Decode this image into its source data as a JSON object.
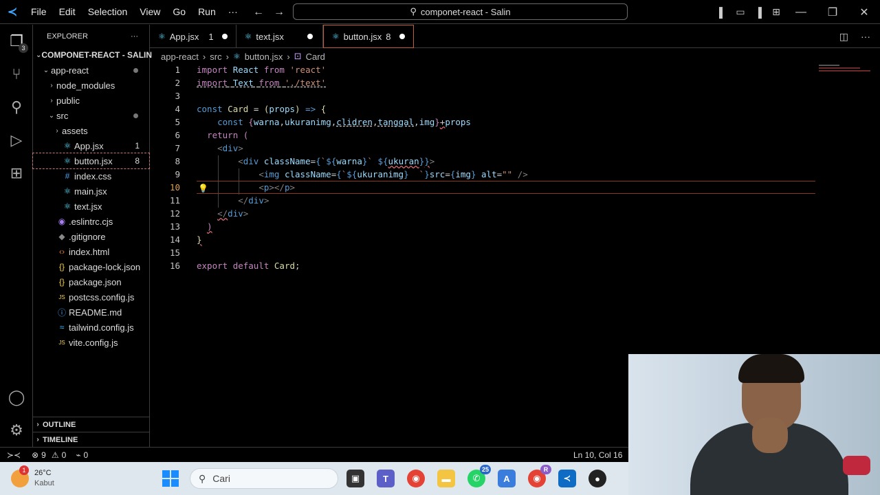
{
  "menu": [
    "File",
    "Edit",
    "Selection",
    "View",
    "Go",
    "Run",
    "···"
  ],
  "command_center": "componet-react - Salin",
  "activity": {
    "explorer_badge": "3"
  },
  "sidebar": {
    "header": "EXPLORER",
    "more": "···",
    "project": "COMPONET-REACT - SALIN",
    "items": [
      {
        "label": "app-react",
        "type": "folder-open",
        "indent": 1
      },
      {
        "label": "node_modules",
        "type": "folder",
        "indent": 2
      },
      {
        "label": "public",
        "type": "folder",
        "indent": 2
      },
      {
        "label": "src",
        "type": "folder-open",
        "indent": 2
      },
      {
        "label": "assets",
        "type": "folder",
        "indent": 3
      },
      {
        "label": "App.jsx",
        "type": "react",
        "indent": 3,
        "badge": "1"
      },
      {
        "label": "button.jsx",
        "type": "react",
        "indent": 3,
        "badge": "8"
      },
      {
        "label": "index.css",
        "type": "css",
        "indent": 3
      },
      {
        "label": "main.jsx",
        "type": "react",
        "indent": 3
      },
      {
        "label": "text.jsx",
        "type": "react",
        "indent": 3
      },
      {
        "label": ".eslintrc.cjs",
        "type": "eslint",
        "indent": 2
      },
      {
        "label": ".gitignore",
        "type": "git",
        "indent": 2
      },
      {
        "label": "index.html",
        "type": "html",
        "indent": 2
      },
      {
        "label": "package-lock.json",
        "type": "json",
        "indent": 2
      },
      {
        "label": "package.json",
        "type": "json",
        "indent": 2
      },
      {
        "label": "postcss.config.js",
        "type": "js",
        "indent": 2
      },
      {
        "label": "README.md",
        "type": "info",
        "indent": 2
      },
      {
        "label": "tailwind.config.js",
        "type": "tailwind",
        "indent": 2
      },
      {
        "label": "vite.config.js",
        "type": "js",
        "indent": 2
      }
    ],
    "outline": "OUTLINE",
    "timeline": "TIMELINE"
  },
  "tabs": [
    {
      "label": "App.jsx",
      "count": "1",
      "active": false
    },
    {
      "label": "text.jsx",
      "count": "",
      "active": false
    },
    {
      "label": "button.jsx",
      "count": "8",
      "active": true
    }
  ],
  "breadcrumb": [
    "app-react",
    "src",
    "button.jsx",
    "Card"
  ],
  "status": {
    "errors": "9",
    "warnings": "0",
    "ports": "0",
    "position": "Ln 10, Col 16"
  },
  "taskbar": {
    "temp": "26°C",
    "weather": "Kabut",
    "weather_badge": "1",
    "search": "Cari",
    "whatsapp_badge": "25",
    "chrome_badge": "R"
  },
  "colors": {
    "accent": "#3ea6ff",
    "active_tab_border": "#c0603a"
  }
}
